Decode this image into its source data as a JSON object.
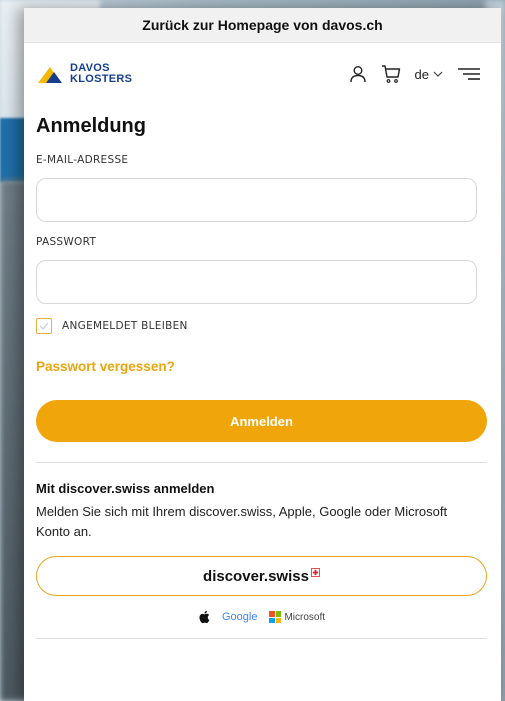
{
  "banner": {
    "text": "Zurück zur Homepage von davos.ch"
  },
  "header": {
    "logo_line1": "DAVOS",
    "logo_line2": "KLOSTERS",
    "language": "de",
    "colors": {
      "logo_blue": "#163d8c",
      "logo_yellow": "#f5b800"
    }
  },
  "login": {
    "title": "Anmeldung",
    "email_label": "E-MAIL-ADRESSE",
    "email_value": "",
    "password_label": "PASSWORT",
    "password_value": "",
    "remember_label": "ANGEMELDET BLEIBEN",
    "remember_checked": true,
    "forgot_link": "Passwort vergessen?",
    "submit_label": "Anmelden"
  },
  "sso": {
    "title": "Mit discover.swiss anmelden",
    "description": "Melden Sie sich mit Ihrem discover.swiss, Apple, Google oder Microsoft Konto an.",
    "discover_label": "discover.swiss",
    "providers": {
      "apple": "apple-icon",
      "google": "Google",
      "microsoft": "Microsoft"
    }
  },
  "colors": {
    "accent": "#f0a60a",
    "accent_text": "#eaa50c",
    "border": "#d7d7d7"
  }
}
